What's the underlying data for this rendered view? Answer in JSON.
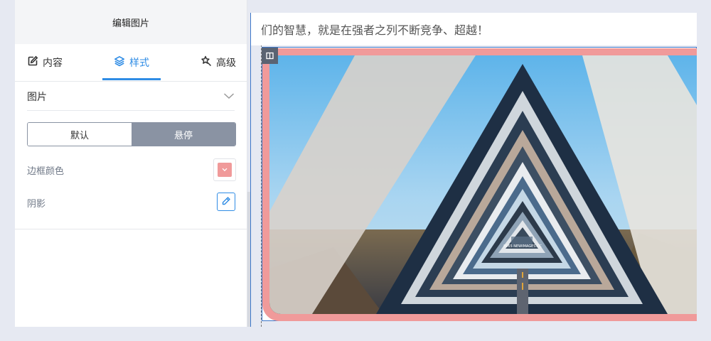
{
  "panel": {
    "title": "编辑图片",
    "tabs": [
      {
        "label": "内容",
        "icon": "edit-icon"
      },
      {
        "label": "样式",
        "icon": "layers-icon"
      },
      {
        "label": "高级",
        "icon": "magic-icon"
      }
    ],
    "section_title": "图片",
    "state_toggle": {
      "default_label": "默认",
      "hover_label": "悬停",
      "active": "悬停"
    },
    "border_color_label": "边框颜色",
    "border_color": "#f09a9a",
    "shadow_label": "阴影"
  },
  "canvas": {
    "text_line": "们的智慧，就是在强者之列不断竞争、超越！",
    "image_watermark": "8965 NEWIMAGES.CC"
  },
  "colors": {
    "accent": "#2f8ce5",
    "toggle_active_bg": "#8a93a3",
    "frame": "#f09a9a"
  }
}
